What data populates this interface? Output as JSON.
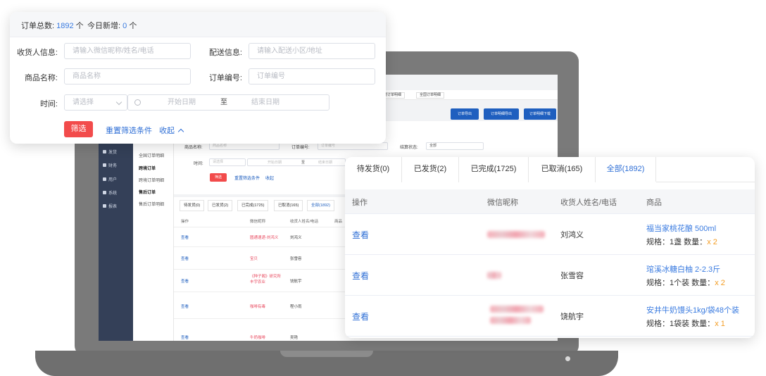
{
  "mini_admin": {
    "sidebar": [
      "发货",
      "财务",
      "用户",
      "系统",
      "报表"
    ],
    "sub_nav": {
      "items": [
        "全国订单明细",
        "跨境订单",
        "跨境订单明细",
        "售后订单",
        "售后订单明细"
      ]
    },
    "tabs": [
      "跨境订单明细",
      "全国订单明细"
    ],
    "buttons": [
      "订单导出",
      "订单明细导出",
      "订单明细下载"
    ],
    "filter": {
      "goods_label": "商品名称:",
      "goods_placeholder": "商品名称",
      "order_label": "订单编号:",
      "order_placeholder": "订单编号",
      "settle_label": "结算状态:",
      "settle_value": "全部",
      "time_label": "时间:",
      "time_placeholder": "请选择",
      "start": "开始日期",
      "to": "至",
      "end": "结束日期",
      "search": "筛选",
      "reset": "重置筛选条件",
      "collapse": "收起"
    },
    "table_tabs": [
      "待发货(0)",
      "已发货(2)",
      "已完成(1725)",
      "已取消(165)",
      "全部(1892)"
    ],
    "headers": [
      "操作",
      "微信昵称",
      "收货人姓名/电话",
      "商品"
    ],
    "rows": [
      {
        "action": "查看",
        "nick": "圆通速递-刘鸿义",
        "name": "刘鸿义"
      },
      {
        "action": "查看",
        "nick": "宝贝",
        "name": "张雪容"
      },
      {
        "action": "查看",
        "nick": "《种子阁》研究所 丰宇农业",
        "name": "饶航宇"
      },
      {
        "action": "查看",
        "nick": "咖啡有毒",
        "name": "程小雨"
      },
      {
        "action": "查看",
        "nick": "牛奶咖啡",
        "name": "吴艳"
      }
    ]
  },
  "filter_card": {
    "total_label": "订单总数:",
    "total_value": "1892",
    "total_unit": "个",
    "today_label": "今日新增:",
    "today_value": "0",
    "today_unit": "个",
    "receiver_label": "收货人信息:",
    "receiver_placeholder": "请输入微信昵称/姓名/电话",
    "delivery_label": "配送信息:",
    "delivery_placeholder": "请输入配送小区/地址",
    "goods_label": "商品名称:",
    "goods_placeholder": "商品名称",
    "order_label": "订单编号:",
    "order_placeholder": "订单编号",
    "time_label": "时间:",
    "time_placeholder": "请选择",
    "start_placeholder": "开始日期",
    "to": "至",
    "end_placeholder": "结束日期",
    "search_button": "筛选",
    "reset_link": "重置筛选条件",
    "collapse_link": "收起"
  },
  "table_card": {
    "tabs": [
      "待发货(0)",
      "已发货(2)",
      "已完成(1725)",
      "已取消(165)",
      "全部(1892)"
    ],
    "active_tab": "全部(1892)",
    "headers": [
      "操作",
      "微信昵称",
      "收货人姓名/电话",
      "商品"
    ],
    "rows": [
      {
        "action": "查看",
        "name": "刘鸿义",
        "product": "福当家桃花酿 500ml",
        "spec_prefix": "规格：1盏 数量：",
        "qty": "x 2"
      },
      {
        "action": "查看",
        "name": "张雪容",
        "product": "琯溪冰糖白柚 2-2.3斤",
        "spec_prefix": "规格：1个装 数量：",
        "qty": "x 2"
      },
      {
        "action": "查看",
        "name": "饶航宇",
        "product": "安井牛奶馒头1kg/袋48个装",
        "spec_prefix": "规格：1袋装 数量：",
        "qty": "x 1"
      }
    ]
  },
  "colors": {
    "accent_blue": "#2f6fd6",
    "danger_red": "#f24b4b",
    "qty_orange": "#f39c22",
    "sidebar_dark": "#344058"
  }
}
